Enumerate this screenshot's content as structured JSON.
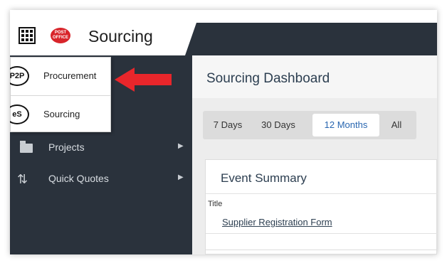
{
  "app": {
    "title": "Sourcing",
    "logo_text": "POST OFFICE",
    "grid_icon": "apps-grid-icon"
  },
  "app_switcher": {
    "items": [
      {
        "badge": "P2P",
        "label": "Procurement",
        "icon": "p2p-badge-icon"
      },
      {
        "badge": "eS",
        "label": "Sourcing",
        "icon": "es-badge-icon"
      }
    ]
  },
  "sidebar": {
    "items": [
      {
        "label": "Projects",
        "icon": "folder-icon",
        "caret": "▶"
      },
      {
        "label": "Quick Quotes",
        "icon": "sort-arrows-icon",
        "caret": "▶"
      }
    ]
  },
  "main": {
    "title": "Sourcing Dashboard",
    "tabs": [
      {
        "label": "7 Days"
      },
      {
        "label": "30 Days"
      },
      {
        "label": "12 Months",
        "active": true
      },
      {
        "label": "All"
      }
    ],
    "event_summary": {
      "title": "Event Summary",
      "column_header": "Title",
      "rows": [
        {
          "title": "Supplier Registration Form"
        }
      ]
    }
  },
  "colors": {
    "dark_nav": "#2a323c",
    "accent": "#2866b0",
    "arrow": "#e8262b",
    "logo": "#d8242a"
  }
}
